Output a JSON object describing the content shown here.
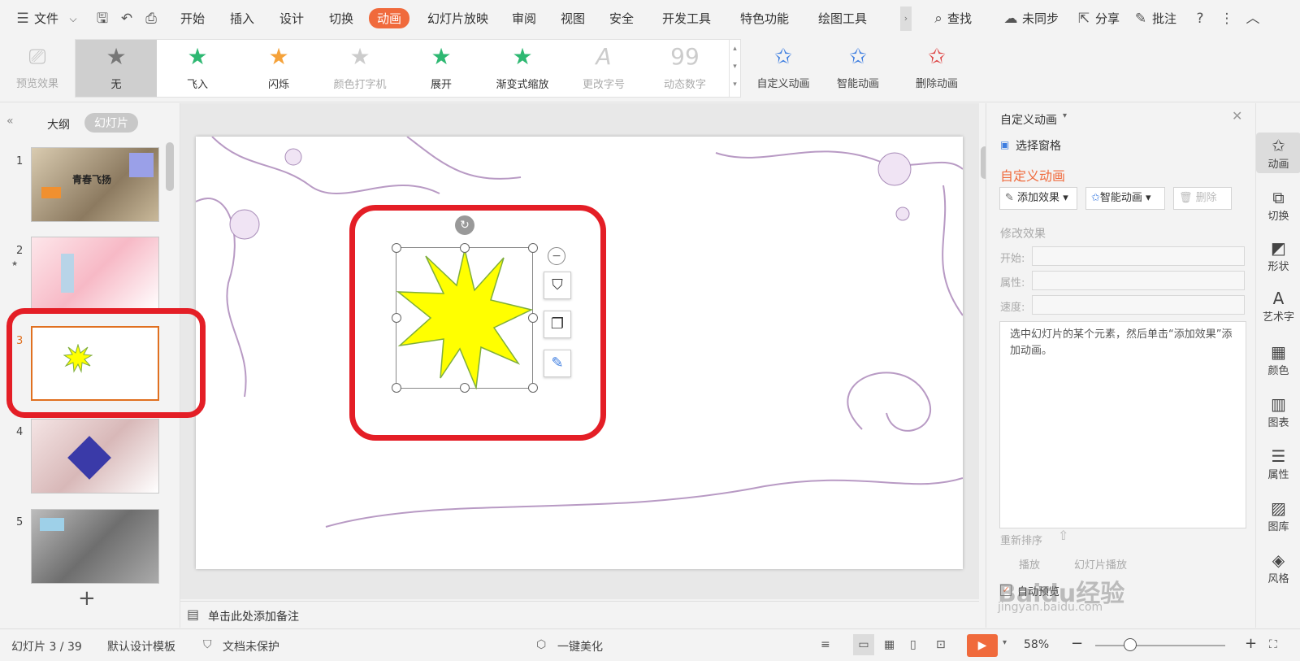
{
  "menubar": {
    "file_label": "文件",
    "tabs": [
      "开始",
      "插入",
      "设计",
      "切换",
      "动画",
      "幻灯片放映",
      "审阅",
      "视图",
      "安全",
      "开发工具",
      "特色功能",
      "绘图工具"
    ],
    "active_tab": "动画",
    "search_label": "查找",
    "sync_label": "未同步",
    "share_label": "分享",
    "comment_label": "批注"
  },
  "ribbon": {
    "preview_label": "预览效果",
    "gallery": [
      {
        "label": "无",
        "icon": "star-gray-icon"
      },
      {
        "label": "飞入",
        "icon": "star-green-icon"
      },
      {
        "label": "闪烁",
        "icon": "star-orange-icon"
      },
      {
        "label": "颜色打字机",
        "icon": "star-gray-icon"
      },
      {
        "label": "展开",
        "icon": "star-green-icon"
      },
      {
        "label": "渐变式缩放",
        "icon": "star-green-icon"
      },
      {
        "label": "更改字号",
        "icon": "letter-a-icon"
      },
      {
        "label": "动态数字",
        "icon": "number-99-icon"
      }
    ],
    "custom_anim_label": "自定义动画",
    "smart_anim_label": "智能动画",
    "delete_anim_label": "删除动画"
  },
  "leftpanel": {
    "outline_tab": "大纲",
    "slides_tab": "幻灯片",
    "slide_numbers": [
      "1",
      "2",
      "3",
      "4",
      "5"
    ],
    "selected_slide": "3",
    "slide1_title": "青春飞扬"
  },
  "notes": {
    "placeholder": "单击此处添加备注"
  },
  "rightpane": {
    "title": "自定义动画",
    "select_pane": "选择窗格",
    "section_title": "自定义动画",
    "add_effect": "添加效果",
    "smart_anim": "智能动画",
    "delete": "删除",
    "modify_effect": "修改效果",
    "start_label": "开始:",
    "property_label": "属性:",
    "speed_label": "速度:",
    "hint": "选中幻灯片的某个元素，然后单击“添加效果”添加动画。",
    "reorder": "重新排序",
    "play": "播放",
    "slideshow": "幻灯片播放",
    "auto_preview": "自动预览"
  },
  "sidebar": {
    "items": [
      "动画",
      "切换",
      "形状",
      "艺术字",
      "颜色",
      "图表",
      "属性",
      "图库",
      "风格"
    ]
  },
  "statusbar": {
    "slide_info": "幻灯片 3 / 39",
    "template": "默认设计模板",
    "protection": "文档未保护",
    "beautify": "一键美化",
    "zoom": "58%"
  },
  "watermark": {
    "text": "Baidu经验",
    "url": "jingyan.baidu.com"
  },
  "colors": {
    "accent": "#f06a3c",
    "highlight_red": "#e41e26",
    "starburst": "#ffff00"
  }
}
